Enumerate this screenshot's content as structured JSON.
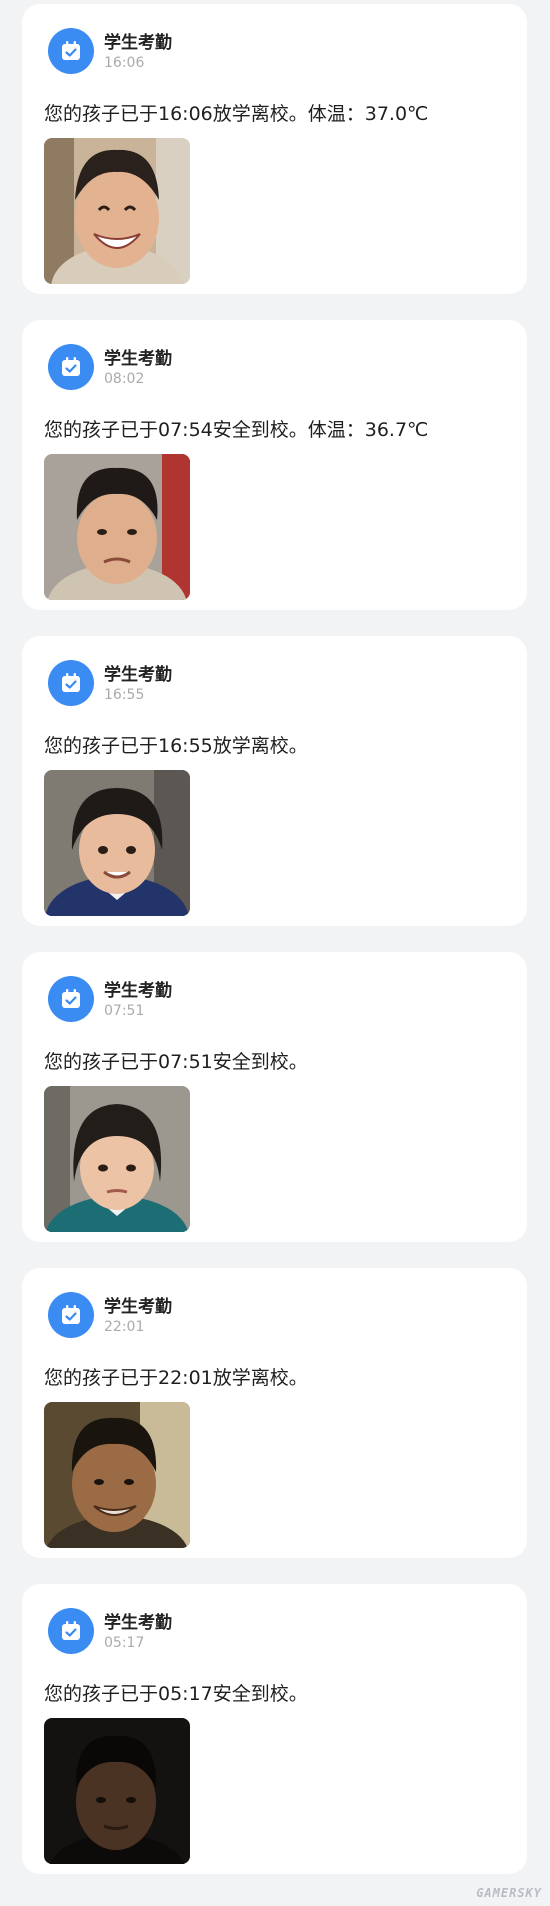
{
  "app_name": "学生考勤",
  "watermark": "GAMERSKY",
  "cards": [
    {
      "time": "16:06",
      "message": "您的孩子已于16:06放学离校。体温：37.0℃",
      "photo": "smiling-child-photo"
    },
    {
      "time": "08:02",
      "message": "您的孩子已于07:54安全到校。体温：36.7℃",
      "photo": "frowning-child-photo"
    },
    {
      "time": "16:55",
      "message": "您的孩子已于16:55放学离校。",
      "photo": "girl-child-photo"
    },
    {
      "time": "07:51",
      "message": "您的孩子已于07:51安全到校。",
      "photo": "girl-child-photo"
    },
    {
      "time": "22:01",
      "message": "您的孩子已于22:01放学离校。",
      "photo": "smiling-teen-photo"
    },
    {
      "time": "05:17",
      "message": "您的孩子已于05:17安全到校。",
      "photo": "dark-teen-photo"
    }
  ],
  "colors": {
    "background": "#f2f3f5",
    "card": "#ffffff",
    "icon_blue": "#3a8cf2",
    "time_gray": "#aaaaaa"
  }
}
